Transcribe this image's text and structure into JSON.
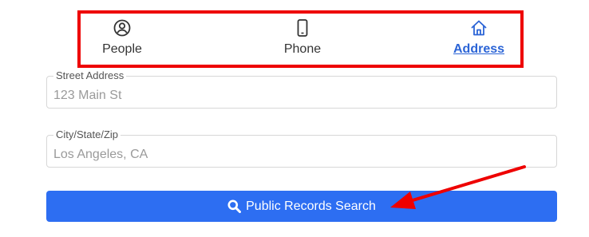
{
  "tabs": {
    "people": {
      "label": "People",
      "icon": "person-circle-icon"
    },
    "phone": {
      "label": "Phone",
      "icon": "phone-icon"
    },
    "address": {
      "label": "Address",
      "icon": "house-icon",
      "active": true
    }
  },
  "fields": {
    "street": {
      "label": "Street Address",
      "placeholder": "123 Main St",
      "value": ""
    },
    "city": {
      "label": "City/State/Zip",
      "placeholder": "Los Angeles, CA",
      "value": ""
    }
  },
  "search_button": {
    "label": "Public Records Search",
    "icon": "search-icon"
  },
  "colors": {
    "accent": "#2b64d6",
    "button": "#2d6ef2",
    "annotation": "#ee0000"
  }
}
